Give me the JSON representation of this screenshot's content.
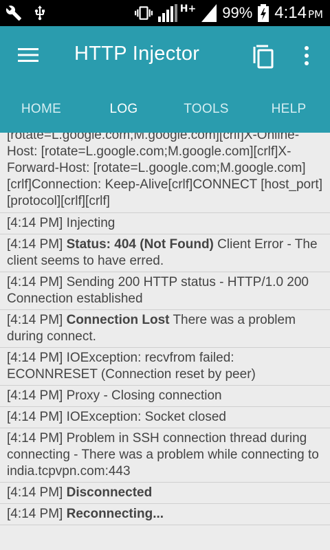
{
  "status_bar": {
    "battery_percent": "99%",
    "time": "4:14",
    "ampm": "PM",
    "network": "H+"
  },
  "app_bar": {
    "title": "HTTP Injector",
    "color": "#2a9cae"
  },
  "tabs": [
    {
      "label": "HOME",
      "active": false
    },
    {
      "label": "LOG",
      "active": true
    },
    {
      "label": "TOOLS",
      "active": false
    },
    {
      "label": "HELP",
      "active": false
    }
  ],
  "log": {
    "payload_text": "[rotate=L.google.com;M.google.com][crlf]X-Online-Host: [rotate=L.google.com;M.google.com][crlf]X-Forward-Host: [rotate=L.google.com;M.google.com][crlf]Connection: Keep-Alive[crlf]CONNECT [host_port] [protocol][crlf][crlf]",
    "entries": [
      {
        "time": "[4:14 PM]",
        "bold": "",
        "text": "Injecting"
      },
      {
        "time": "[4:14 PM]",
        "bold": "Status: 404 (Not Found)",
        "text": "Client Error - The client seems to have erred."
      },
      {
        "time": "[4:14 PM]",
        "bold": "",
        "text": "Sending 200 HTTP status - HTTP/1.0 200 Connection established"
      },
      {
        "time": "[4:14 PM]",
        "bold": "Connection Lost",
        "text": "There was a problem during connect."
      },
      {
        "time": "[4:14 PM]",
        "bold": "",
        "text": "IOException: recvfrom failed: ECONNRESET (Connection reset by peer)"
      },
      {
        "time": "[4:14 PM]",
        "bold": "",
        "text": "Proxy - Closing connection"
      },
      {
        "time": "[4:14 PM]",
        "bold": "",
        "text": "IOException: Socket closed"
      },
      {
        "time": "[4:14 PM]",
        "bold": "",
        "text": "Problem in SSH connection thread during connecting - There was a problem while connecting to india.tcpvpn.com:443"
      },
      {
        "time": "[4:14 PM]",
        "bold": "Disconnected",
        "text": ""
      },
      {
        "time": "[4:14 PM]",
        "bold": "Reconnecting...",
        "text": ""
      }
    ]
  }
}
